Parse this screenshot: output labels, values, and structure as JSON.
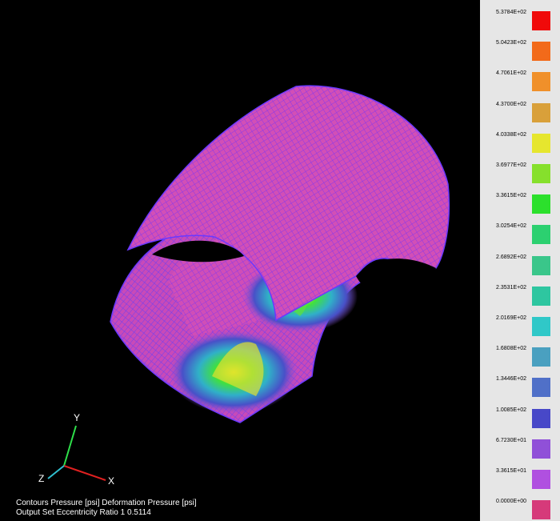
{
  "legend": {
    "levels": [
      {
        "label": "5.3784E+02",
        "color": "#f00a0a"
      },
      {
        "label": "5.0423E+02",
        "color": "#f26a1a"
      },
      {
        "label": "4.7061E+02",
        "color": "#f0902a"
      },
      {
        "label": "4.3700E+02",
        "color": "#d9a03a"
      },
      {
        "label": "4.0338E+02",
        "color": "#e6e62e"
      },
      {
        "label": "3.6977E+02",
        "color": "#86e02c"
      },
      {
        "label": "3.3615E+02",
        "color": "#2ce02c"
      },
      {
        "label": "3.0254E+02",
        "color": "#2cd070"
      },
      {
        "label": "2.6892E+02",
        "color": "#3ac68a"
      },
      {
        "label": "2.3531E+02",
        "color": "#2ec6a0"
      },
      {
        "label": "2.0169E+02",
        "color": "#30c8c8"
      },
      {
        "label": "1.6808E+02",
        "color": "#4aa0c0"
      },
      {
        "label": "1.3446E+02",
        "color": "#5070c8"
      },
      {
        "label": "1.0085E+02",
        "color": "#4848c8"
      },
      {
        "label": "6.7230E+01",
        "color": "#9050d8"
      },
      {
        "label": "3.3615E+01",
        "color": "#b050e0"
      },
      {
        "label": "0.0000E+00",
        "color": "#d63a7a"
      }
    ]
  },
  "triad": {
    "x": "X",
    "y": "Y",
    "z": "Z"
  },
  "status": {
    "line1": "Contours  Pressure [psi]    Deformation  Pressure [psi]",
    "line2": "Output Set   Eccentricity Ratio  1    0.5114"
  },
  "colors": {
    "background": "#000000",
    "mesh_base": "#d855b8",
    "mesh_edge": "#7a3aff"
  }
}
